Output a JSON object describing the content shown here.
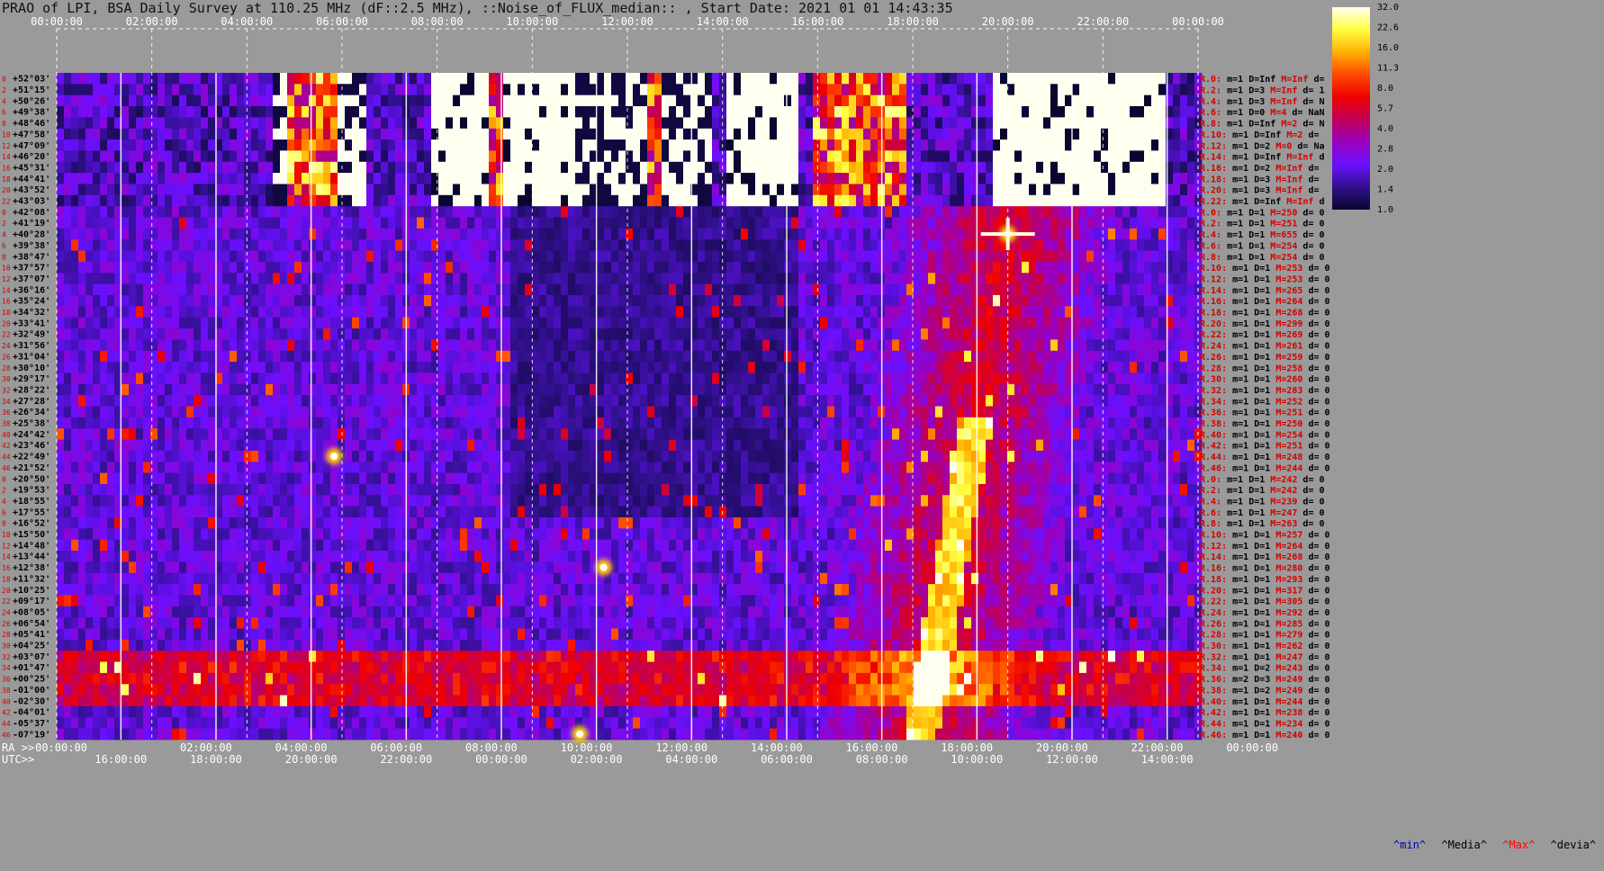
{
  "title": "PRAO of LPI, BSA Daily Survey at 110.25 MHz (dF::2.5 MHz), ::Noise_of_FLUX_median:: , Start Date: 2021 01 01 14:43:35",
  "colors": {
    "background": "#9a9a9a",
    "plot_background": "#0a0420",
    "ra_label": "#d40000",
    "footer_min": "#0000aa",
    "footer_max": "#ff0000"
  },
  "chart_data": {
    "type": "heatmap",
    "top_axis_ticks": [
      "00:00:00",
      "02:00:00",
      "04:00:00",
      "06:00:00",
      "08:00:00",
      "10:00:00",
      "12:00:00",
      "14:00:00",
      "16:00:00",
      "18:00:00",
      "20:00:00",
      "22:00:00",
      "00:00:00"
    ],
    "ra_axis_label": "RA >>",
    "ra_axis_ticks": [
      "00:00:00",
      "02:00:00",
      "04:00:00",
      "06:00:00",
      "08:00:00",
      "10:00:00",
      "12:00:00",
      "14:00:00",
      "16:00:00",
      "18:00:00",
      "20:00:00",
      "22:00:00",
      "00:00:00"
    ],
    "utc_axis_label": "UTC>>",
    "utc_axis_ticks": [
      "16:00:00",
      "18:00:00",
      "20:00:00",
      "22:00:00",
      "00:00:00",
      "02:00:00",
      "04:00:00",
      "06:00:00",
      "08:00:00",
      "10:00:00",
      "12:00:00",
      "14:00:00"
    ],
    "colorbar": {
      "ticks": [
        "32.0",
        "22.6",
        "16.0",
        "11.3",
        "8.0",
        "5.7",
        "4.0",
        "2.8",
        "2.0",
        "1.4",
        "1.0"
      ],
      "stops": [
        "#fffff0",
        "#ffff40",
        "#ffb000",
        "#ff4800",
        "#ee0000",
        "#c0005a",
        "#9a00c0",
        "#6a10ff",
        "#30108a",
        "#0a0630"
      ]
    },
    "declinations": [
      "+52°03'",
      "+51°15'",
      "+50°26'",
      "+49°38'",
      "+48°46'",
      "+47°58'",
      "+47°09'",
      "+46°20'",
      "+45°31'",
      "+44°41'",
      "+43°52'",
      "+43°03'",
      "+42°08'",
      "+41°19'",
      "+40°28'",
      "+39°38'",
      "+38°47'",
      "+37°57'",
      "+37°07'",
      "+36°16'",
      "+35°24'",
      "+34°32'",
      "+33°41'",
      "+32°49'",
      "+31°56'",
      "+31°04'",
      "+30°10'",
      "+29°17'",
      "+28°22'",
      "+27°28'",
      "+26°34'",
      "+25°38'",
      "+24°42'",
      "+23°46'",
      "+22°49'",
      "+21°52'",
      "+20°50'",
      "+19°53'",
      "+18°55'",
      "+17°55'",
      "+16°52'",
      "+15°50'",
      "+14°48'",
      "+13°44'",
      "+12°38'",
      "+11°32'",
      "+10°25'",
      "+09°17'",
      "+08°05'",
      "+06°54'",
      "+05°41'",
      "+04°25'",
      "+03°07'",
      "+01°47'",
      "+00°25'",
      "-01°00'",
      "-02°30'",
      "-04°01'",
      "-05°37'",
      "-07°19'"
    ],
    "row_indices": [
      "0",
      "2",
      "4",
      "6",
      "8",
      "10",
      "12",
      "14",
      "16",
      "18",
      "20",
      "22",
      "0",
      "2",
      "4",
      "6",
      "8",
      "10",
      "12",
      "14",
      "16",
      "18",
      "20",
      "22",
      "24",
      "26",
      "28",
      "30",
      "32",
      "34",
      "36",
      "38",
      "40",
      "42",
      "44",
      "46",
      "0",
      "2",
      "4",
      "6",
      "8",
      "10",
      "12",
      "14",
      "16",
      "18",
      "20",
      "22",
      "24",
      "26",
      "28",
      "30",
      "32",
      "34",
      "36",
      "38",
      "40",
      "42",
      "44",
      "46"
    ],
    "receiver_stats": [
      {
        "r": "R.0:",
        "m": "m=1",
        "d": "D=Inf",
        "M": "M=Inf",
        "dev": "d="
      },
      {
        "r": "R.2:",
        "m": "m=1",
        "d": "D=3",
        "M": "M=Inf",
        "dev": "d= 1"
      },
      {
        "r": "R.4:",
        "m": "m=1",
        "d": "D=3",
        "M": "M=Inf",
        "dev": "d= N"
      },
      {
        "r": "R.6:",
        "m": "m=1",
        "d": "D=0",
        "M": "M=4",
        "dev": "d= NaN"
      },
      {
        "r": "R.8:",
        "m": "m=1",
        "d": "D=Inf",
        "M": "M=2",
        "dev": "d= N"
      },
      {
        "r": "R.10:",
        "m": "m=1",
        "d": "D=Inf",
        "M": "M=2",
        "dev": "d="
      },
      {
        "r": "R.12:",
        "m": "m=1",
        "d": "D=2",
        "M": "M=0",
        "dev": "d= Na"
      },
      {
        "r": "R.14:",
        "m": "m=1",
        "d": "D=Inf",
        "M": "M=Inf",
        "dev": "d"
      },
      {
        "r": "R.16:",
        "m": "m=1",
        "d": "D=2",
        "M": "M=Inf",
        "dev": "d="
      },
      {
        "r": "R.18:",
        "m": "m=1",
        "d": "D=3",
        "M": "M=Inf",
        "dev": "d="
      },
      {
        "r": "R.20:",
        "m": "m=1",
        "d": "D=3",
        "M": "M=Inf",
        "dev": "d="
      },
      {
        "r": "R.22:",
        "m": "m=1",
        "d": "D=Inf",
        "M": "M=Inf",
        "dev": "d"
      },
      {
        "r": "R.0:",
        "m": "m=1",
        "d": "D=1",
        "M": "M=250",
        "dev": "d= 0"
      },
      {
        "r": "R.2:",
        "m": "m=1",
        "d": "D=1",
        "M": "M=251",
        "dev": "d= 0"
      },
      {
        "r": "R.4:",
        "m": "m=1",
        "d": "D=1",
        "M": "M=655",
        "dev": "d= 0"
      },
      {
        "r": "R.6:",
        "m": "m=1",
        "d": "D=1",
        "M": "M=254",
        "dev": "d= 0"
      },
      {
        "r": "R.8:",
        "m": "m=1",
        "d": "D=1",
        "M": "M=254",
        "dev": "d= 0"
      },
      {
        "r": "R.10:",
        "m": "m=1",
        "d": "D=1",
        "M": "M=253",
        "dev": "d= 0"
      },
      {
        "r": "R.12:",
        "m": "m=1",
        "d": "D=1",
        "M": "M=253",
        "dev": "d= 0"
      },
      {
        "r": "R.14:",
        "m": "m=1",
        "d": "D=1",
        "M": "M=265",
        "dev": "d= 0"
      },
      {
        "r": "R.16:",
        "m": "m=1",
        "d": "D=1",
        "M": "M=264",
        "dev": "d= 0"
      },
      {
        "r": "R.18:",
        "m": "m=1",
        "d": "D=1",
        "M": "M=268",
        "dev": "d= 0"
      },
      {
        "r": "R.20:",
        "m": "m=1",
        "d": "D=1",
        "M": "M=299",
        "dev": "d= 0"
      },
      {
        "r": "R.22:",
        "m": "m=1",
        "d": "D=1",
        "M": "M=269",
        "dev": "d= 0"
      },
      {
        "r": "R.24:",
        "m": "m=1",
        "d": "D=1",
        "M": "M=261",
        "dev": "d= 0"
      },
      {
        "r": "R.26:",
        "m": "m=1",
        "d": "D=1",
        "M": "M=259",
        "dev": "d= 0"
      },
      {
        "r": "R.28:",
        "m": "m=1",
        "d": "D=1",
        "M": "M=258",
        "dev": "d= 0"
      },
      {
        "r": "R.30:",
        "m": "m=1",
        "d": "D=1",
        "M": "M=260",
        "dev": "d= 0"
      },
      {
        "r": "R.32:",
        "m": "m=1",
        "d": "D=1",
        "M": "M=283",
        "dev": "d= 0"
      },
      {
        "r": "R.34:",
        "m": "m=1",
        "d": "D=1",
        "M": "M=252",
        "dev": "d= 0"
      },
      {
        "r": "R.36:",
        "m": "m=1",
        "d": "D=1",
        "M": "M=251",
        "dev": "d= 0"
      },
      {
        "r": "R.38:",
        "m": "m=1",
        "d": "D=1",
        "M": "M=250",
        "dev": "d= 0"
      },
      {
        "r": "R.40:",
        "m": "m=1",
        "d": "D=1",
        "M": "M=254",
        "dev": "d= 0"
      },
      {
        "r": "R.42:",
        "m": "m=1",
        "d": "D=1",
        "M": "M=251",
        "dev": "d= 0"
      },
      {
        "r": "R.44:",
        "m": "m=1",
        "d": "D=1",
        "M": "M=248",
        "dev": "d= 0"
      },
      {
        "r": "R.46:",
        "m": "m=1",
        "d": "D=1",
        "M": "M=244",
        "dev": "d= 0"
      },
      {
        "r": "R.0:",
        "m": "m=1",
        "d": "D=1",
        "M": "M=242",
        "dev": "d= 0"
      },
      {
        "r": "R.2:",
        "m": "m=1",
        "d": "D=1",
        "M": "M=242",
        "dev": "d= 0"
      },
      {
        "r": "R.4:",
        "m": "m=1",
        "d": "D=1",
        "M": "M=239",
        "dev": "d= 0"
      },
      {
        "r": "R.6:",
        "m": "m=1",
        "d": "D=1",
        "M": "M=247",
        "dev": "d= 0"
      },
      {
        "r": "R.8:",
        "m": "m=1",
        "d": "D=1",
        "M": "M=263",
        "dev": "d= 0"
      },
      {
        "r": "R.10:",
        "m": "m=1",
        "d": "D=1",
        "M": "M=257",
        "dev": "d= 0"
      },
      {
        "r": "R.12:",
        "m": "m=1",
        "d": "D=1",
        "M": "M=264",
        "dev": "d= 0"
      },
      {
        "r": "R.14:",
        "m": "m=1",
        "d": "D=1",
        "M": "M=268",
        "dev": "d= 0"
      },
      {
        "r": "R.16:",
        "m": "m=1",
        "d": "D=1",
        "M": "M=280",
        "dev": "d= 0"
      },
      {
        "r": "R.18:",
        "m": "m=1",
        "d": "D=1",
        "M": "M=293",
        "dev": "d= 0"
      },
      {
        "r": "R.20:",
        "m": "m=1",
        "d": "D=1",
        "M": "M=317",
        "dev": "d= 0"
      },
      {
        "r": "R.22:",
        "m": "m=1",
        "d": "D=1",
        "M": "M=305",
        "dev": "d= 0"
      },
      {
        "r": "R.24:",
        "m": "m=1",
        "d": "D=1",
        "M": "M=292",
        "dev": "d= 0"
      },
      {
        "r": "R.26:",
        "m": "m=1",
        "d": "D=1",
        "M": "M=285",
        "dev": "d= 0"
      },
      {
        "r": "R.28:",
        "m": "m=1",
        "d": "D=1",
        "M": "M=279",
        "dev": "d= 0"
      },
      {
        "r": "R.30:",
        "m": "m=1",
        "d": "D=1",
        "M": "M=262",
        "dev": "d= 0"
      },
      {
        "r": "R.32:",
        "m": "m=1",
        "d": "D=1",
        "M": "M=247",
        "dev": "d= 0"
      },
      {
        "r": "R.34:",
        "m": "m=1",
        "d": "D=2",
        "M": "M=243",
        "dev": "d= 0"
      },
      {
        "r": "R.36:",
        "m": "m=2",
        "d": "D=3",
        "M": "M=249",
        "dev": "d= 0"
      },
      {
        "r": "R.38:",
        "m": "m=1",
        "d": "D=2",
        "M": "M=249",
        "dev": "d= 0"
      },
      {
        "r": "R.40:",
        "m": "m=1",
        "d": "D=1",
        "M": "M=244",
        "dev": "d= 0"
      },
      {
        "r": "R.42:",
        "m": "m=1",
        "d": "D=1",
        "M": "M=238",
        "dev": "d= 0"
      },
      {
        "r": "R.44:",
        "m": "m=1",
        "d": "D=1",
        "M": "M=234",
        "dev": "d= 0"
      },
      {
        "r": "R.46:",
        "m": "m=1",
        "d": "D=1",
        "M": "M=240",
        "dev": "d= 0"
      }
    ],
    "footer_legend": {
      "min": "^min^",
      "median": "^Media^",
      "max": "^Max^",
      "deviation": "^devia^"
    },
    "features": {
      "saturated_band_rows": "0-11",
      "bright_sources": [
        {
          "ra": "20:00:00",
          "dec": "+40°28'",
          "label": ""
        },
        {
          "ra": "11:30:00",
          "dec": "+12°38'",
          "label": ""
        },
        {
          "ra": "05:50:00",
          "dec": "+22°49'",
          "label": ""
        },
        {
          "ra": "11:00:00",
          "dec": "-07°19'",
          "label": ""
        }
      ],
      "galactic_plane_band": "dec +01°47' to -02°30', RA 00:00 to 24:00"
    }
  }
}
